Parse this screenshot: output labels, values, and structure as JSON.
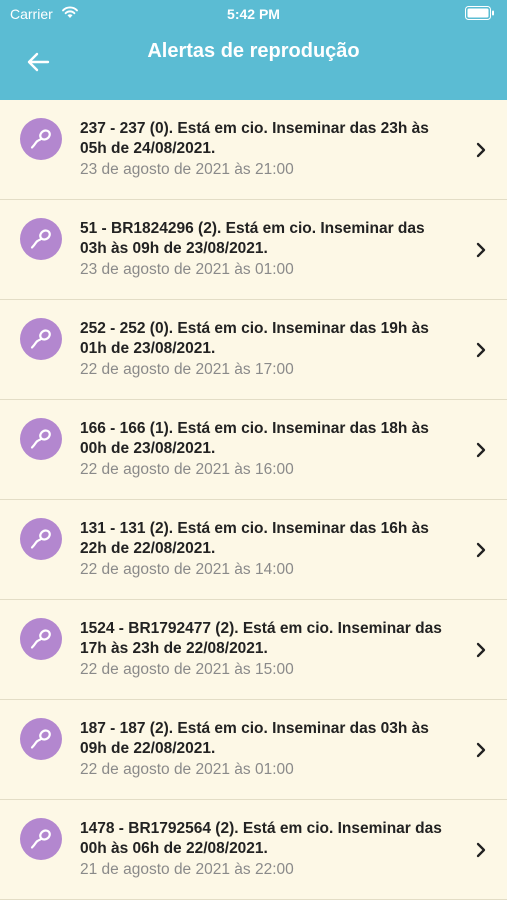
{
  "status_bar": {
    "carrier": "Carrier",
    "time": "5:42 PM",
    "icons": [
      "wifi-icon",
      "battery-icon"
    ]
  },
  "nav": {
    "title": "Alertas de reprodução",
    "back_icon": "arrow-left-icon"
  },
  "colors": {
    "header": "#5bbcd3",
    "background": "#fdf8e6",
    "avatar": "#b387cf"
  },
  "alerts": [
    {
      "icon": "sperm-icon",
      "title": "237 - 237 (0). Está em cio. Inseminar das 23h às 05h de 24/08/2021.",
      "date": "23 de agosto de 2021 às 21:00"
    },
    {
      "icon": "sperm-icon",
      "title": "51 - BR1824296 (2). Está em cio. Inseminar das 03h às 09h de 23/08/2021.",
      "date": "23 de agosto de 2021 às 01:00"
    },
    {
      "icon": "sperm-icon",
      "title": "252 - 252 (0). Está em cio. Inseminar das 19h às 01h de 23/08/2021.",
      "date": "22 de agosto de 2021 às 17:00"
    },
    {
      "icon": "sperm-icon",
      "title": "166 - 166 (1). Está em cio. Inseminar das 18h às 00h de 23/08/2021.",
      "date": "22 de agosto de 2021 às 16:00"
    },
    {
      "icon": "sperm-icon",
      "title": "131 - 131 (2). Está em cio. Inseminar das 16h às 22h de 22/08/2021.",
      "date": "22 de agosto de 2021 às 14:00"
    },
    {
      "icon": "sperm-icon",
      "title": "1524 - BR1792477 (2). Está em cio. Inseminar das 17h às 23h de 22/08/2021.",
      "date": "22 de agosto de 2021 às 15:00"
    },
    {
      "icon": "sperm-icon",
      "title": "187 - 187 (2). Está em cio. Inseminar das 03h às 09h de 22/08/2021.",
      "date": "22 de agosto de 2021 às 01:00"
    },
    {
      "icon": "sperm-icon",
      "title": "1478 - BR1792564 (2). Está em cio. Inseminar das 00h às 06h de 22/08/2021.",
      "date": "21 de agosto de 2021 às 22:00"
    }
  ]
}
